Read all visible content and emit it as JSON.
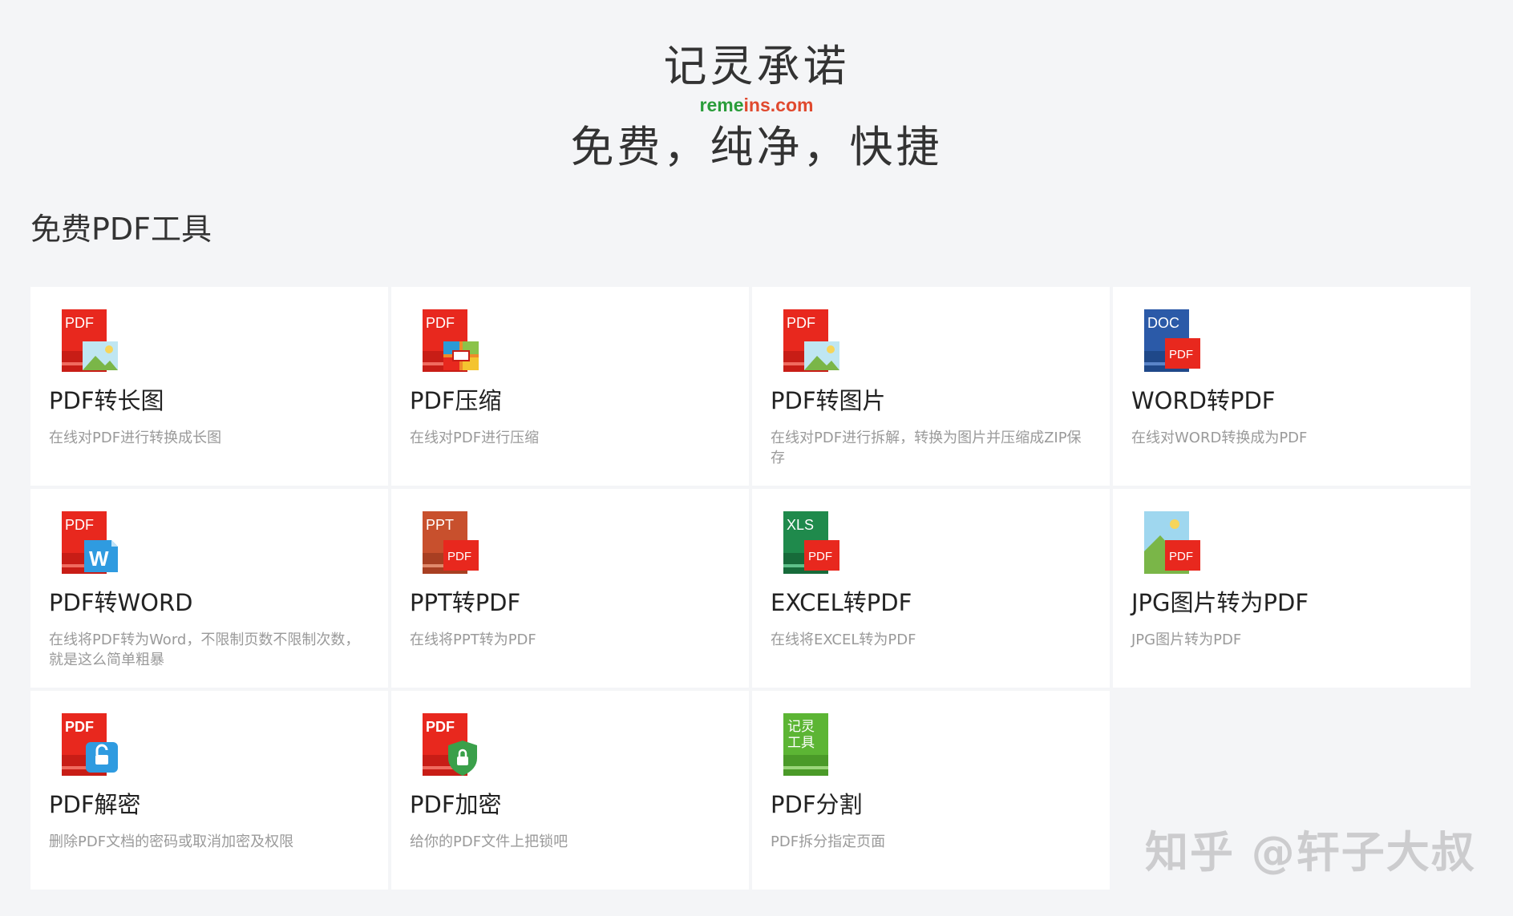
{
  "header": {
    "brand": "记灵承诺",
    "url_part1": "reme",
    "url_part2": "ins.com",
    "slogan": "免费，纯净，快捷"
  },
  "section": {
    "title": "免费PDF工具"
  },
  "tools": [
    {
      "name": "PDF转长图",
      "desc": "在线对PDF进行转换成长图",
      "icon": "pdf-to-long-image-icon"
    },
    {
      "name": "PDF压缩",
      "desc": "在线对PDF进行压缩",
      "icon": "pdf-compress-icon"
    },
    {
      "name": "PDF转图片",
      "desc": "在线对PDF进行拆解，转换为图片并压缩成ZIP保存",
      "icon": "pdf-to-image-icon"
    },
    {
      "name": "WORD转PDF",
      "desc": "在线对WORD转换成为PDF",
      "icon": "word-to-pdf-icon"
    },
    {
      "name": "PDF转WORD",
      "desc": "在线将PDF转为Word，不限制页数不限制次数，就是这么简单粗暴",
      "icon": "pdf-to-word-icon"
    },
    {
      "name": "PPT转PDF",
      "desc": "在线将PPT转为PDF",
      "icon": "ppt-to-pdf-icon"
    },
    {
      "name": "EXCEL转PDF",
      "desc": "在线将EXCEL转为PDF",
      "icon": "excel-to-pdf-icon"
    },
    {
      "name": "JPG图片转为PDF",
      "desc": "JPG图片转为PDF",
      "icon": "jpg-to-pdf-icon"
    },
    {
      "name": "PDF解密",
      "desc": "删除PDF文档的密码或取消加密及权限",
      "icon": "pdf-unlock-icon"
    },
    {
      "name": "PDF加密",
      "desc": "给你的PDF文件上把锁吧",
      "icon": "pdf-lock-icon"
    },
    {
      "name": "PDF分割",
      "desc": "PDF拆分指定页面",
      "icon": "pdf-split-icon"
    }
  ],
  "icon_text": {
    "pdf": "PDF",
    "doc": "DOC",
    "ppt": "PPT",
    "xls": "XLS",
    "w": "W",
    "split_line1": "记灵",
    "split_line2": "工具"
  },
  "watermark": "知乎 @轩子大叔",
  "colors": {
    "pdf_red": "#e8281e",
    "word_blue": "#2b5aa8",
    "ppt_orange": "#c8502d",
    "excel_green": "#1f8a4c",
    "split_green": "#5cb534",
    "url_green": "#2a9d3a",
    "url_red": "#e0492e"
  }
}
